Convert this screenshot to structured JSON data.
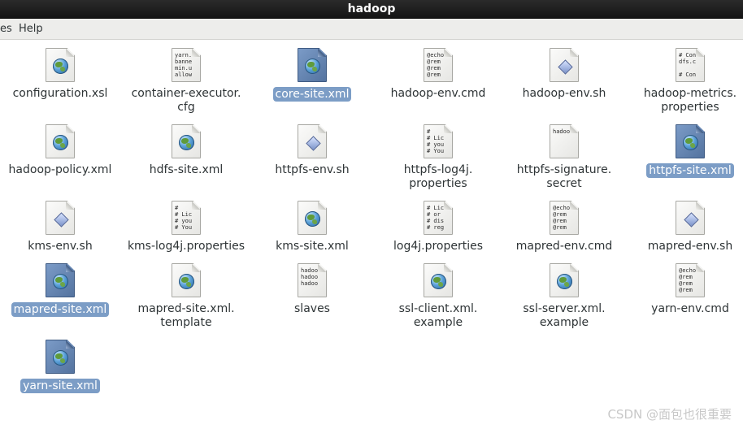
{
  "window": {
    "title": "hadoop"
  },
  "menubar": {
    "items": [
      "es",
      "Help"
    ]
  },
  "files": [
    {
      "name": "configuration.xsl",
      "lines": [
        "configuration.xsl"
      ],
      "icon": "globe-doc-icon",
      "selected": false
    },
    {
      "name": "container-executor.cfg",
      "lines": [
        "container-executor.",
        "cfg"
      ],
      "icon": "text-doc-icon",
      "preview": "yarn.\nbanne\nmin.u\nallow",
      "selected": false
    },
    {
      "name": "core-site.xml",
      "lines": [
        "core-site.xml"
      ],
      "icon": "globe-doc-icon",
      "selected": true
    },
    {
      "name": "hadoop-env.cmd",
      "lines": [
        "hadoop-env.cmd"
      ],
      "icon": "text-doc-icon",
      "preview": "@echo\n@rem\n@rem\n@rem",
      "selected": false
    },
    {
      "name": "hadoop-env.sh",
      "lines": [
        "hadoop-env.sh"
      ],
      "icon": "script-doc-icon",
      "selected": false
    },
    {
      "name": "hadoop-metrics.properties",
      "lines": [
        "hadoop-metrics.",
        "properties"
      ],
      "icon": "text-doc-icon",
      "preview": "# Con\ndfs.c\n\n# Con",
      "selected": false
    },
    {
      "name": "hadoop-policy.xml",
      "lines": [
        "hadoop-policy.xml"
      ],
      "icon": "globe-doc-icon",
      "selected": false
    },
    {
      "name": "hdfs-site.xml",
      "lines": [
        "hdfs-site.xml"
      ],
      "icon": "globe-doc-icon",
      "selected": false
    },
    {
      "name": "httpfs-env.sh",
      "lines": [
        "httpfs-env.sh"
      ],
      "icon": "script-doc-icon",
      "selected": false
    },
    {
      "name": "httpfs-log4j.properties",
      "lines": [
        "httpfs-log4j.",
        "properties"
      ],
      "icon": "text-doc-icon",
      "preview": "#\n# Lic\n# you\n# You",
      "selected": false
    },
    {
      "name": "httpfs-signature.secret",
      "lines": [
        "httpfs-signature.",
        "secret"
      ],
      "icon": "text-doc-icon",
      "preview": "hadoo",
      "selected": false
    },
    {
      "name": "httpfs-site.xml",
      "lines": [
        "httpfs-site.xml"
      ],
      "icon": "globe-doc-icon",
      "selected": true
    },
    {
      "name": "kms-env.sh",
      "lines": [
        "kms-env.sh"
      ],
      "icon": "script-doc-icon",
      "selected": false
    },
    {
      "name": "kms-log4j.properties",
      "lines": [
        "kms-log4j.properties"
      ],
      "icon": "text-doc-icon",
      "preview": "#\n# Lic\n# you\n# You",
      "selected": false
    },
    {
      "name": "kms-site.xml",
      "lines": [
        "kms-site.xml"
      ],
      "icon": "globe-doc-icon",
      "selected": false
    },
    {
      "name": "log4j.properties",
      "lines": [
        "log4j.properties"
      ],
      "icon": "text-doc-icon",
      "preview": "# Lic\n# or\n# dis\n# reg",
      "selected": false
    },
    {
      "name": "mapred-env.cmd",
      "lines": [
        "mapred-env.cmd"
      ],
      "icon": "text-doc-icon",
      "preview": "@echo\n@rem\n@rem\n@rem",
      "selected": false
    },
    {
      "name": "mapred-env.sh",
      "lines": [
        "mapred-env.sh"
      ],
      "icon": "script-doc-icon",
      "selected": false
    },
    {
      "name": "mapred-site.xml",
      "lines": [
        "mapred-site.xml"
      ],
      "icon": "globe-doc-icon",
      "selected": true
    },
    {
      "name": "mapred-site.xml.template",
      "lines": [
        "mapred-site.xml.",
        "template"
      ],
      "icon": "globe-doc-icon",
      "selected": false
    },
    {
      "name": "slaves",
      "lines": [
        "slaves"
      ],
      "icon": "text-doc-icon",
      "preview": "hadoo\nhadoo\nhadoo",
      "selected": false
    },
    {
      "name": "ssl-client.xml.example",
      "lines": [
        "ssl-client.xml.",
        "example"
      ],
      "icon": "globe-doc-icon",
      "selected": false
    },
    {
      "name": "ssl-server.xml.example",
      "lines": [
        "ssl-server.xml.",
        "example"
      ],
      "icon": "globe-doc-icon",
      "selected": false
    },
    {
      "name": "yarn-env.cmd",
      "lines": [
        "yarn-env.cmd"
      ],
      "icon": "text-doc-icon",
      "preview": "@echo\n@rem\n@rem\n@rem",
      "selected": false
    },
    {
      "name": "yarn-site.xml",
      "lines": [
        "yarn-site.xml"
      ],
      "icon": "globe-doc-icon",
      "selected": true
    }
  ],
  "watermark": "CSDN @面包也很重要"
}
